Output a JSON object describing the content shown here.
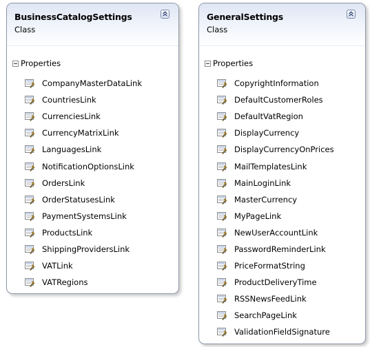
{
  "shapes": [
    {
      "title": "BusinessCatalogSettings",
      "kind": "Class",
      "section": "Properties",
      "items": [
        "CompanyMasterDataLink",
        "CountriesLink",
        "CurrenciesLink",
        "CurrencyMatrixLink",
        "LanguagesLink",
        "NotificationOptionsLink",
        "OrdersLink",
        "OrderStatusesLink",
        "PaymentSystemsLink",
        "ProductsLink",
        "ShippingProvidersLink",
        "VATLink",
        "VATRegions"
      ]
    },
    {
      "title": "GeneralSettings",
      "kind": "Class",
      "section": "Properties",
      "items": [
        "CopyrightInformation",
        "DefaultCustomerRoles",
        "DefaultVatRegion",
        "DisplayCurrency",
        "DisplayCurrencyOnPrices",
        "MailTemplatesLink",
        "MainLoginLink",
        "MasterCurrency",
        "MyPageLink",
        "NewUserAccountLink",
        "PasswordReminderLink",
        "PriceFormatString",
        "ProductDeliveryTime",
        "RSSNewsFeedLink",
        "SearchPageLink",
        "ValidationFieldSignature"
      ]
    }
  ],
  "icons": {
    "collapse": "chevron-up-double-icon",
    "expander": "minus-box-icon",
    "property": "property-wrench-icon"
  }
}
